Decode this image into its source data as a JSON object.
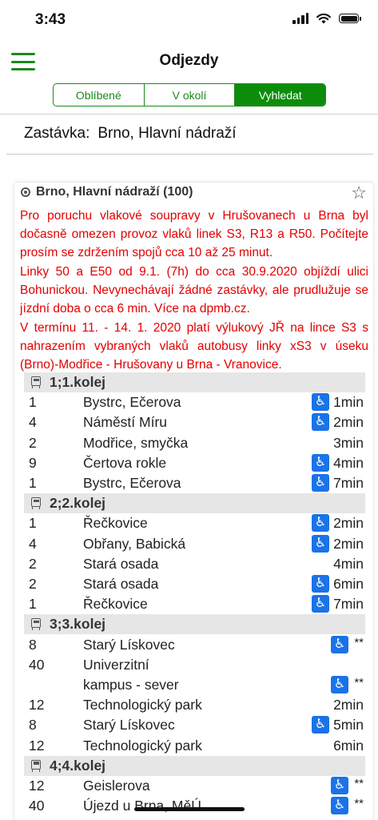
{
  "status_bar": {
    "time": "3:43"
  },
  "nav": {
    "title": "Odjezdy",
    "tabs": [
      {
        "label": "Oblíbené",
        "active": false
      },
      {
        "label": "V okolí",
        "active": false
      },
      {
        "label": "Vyhledat",
        "active": true
      }
    ]
  },
  "stop": {
    "label": "Zastávka:",
    "value": "Brno, Hlavní nádraží"
  },
  "card": {
    "title": "Brno, Hlavní nádraží (100)",
    "notices": [
      "Pro poruchu vlakové soupravy v Hrušovanech u Brna byl dočasně omezen provoz vlaků linek S3, R13 a R50. Počítejte prosím se zdržením spojů cca 10 až 25 minut.",
      "Linky 50 a E50 od 9.1. (7h) do cca 30.9.2020 objíždí ulici Bohunickou. Nevynechávají žádné zastávky, ale prudlužuje se jízdní doba o cca 6 min. Více na dpmb.cz.",
      "V termínu 11. - 14. 1. 2020 platí výlukový JŘ na lince S3 s nahrazením vybraných vlaků autobusy linky xS3 v úseku (Brno)-Modřice - Hrušovany u Brna - Vranovice."
    ],
    "platforms": [
      {
        "name": "1;1.kolej",
        "departures": [
          {
            "line": "1",
            "destination": "Bystrc, Ečerova",
            "accessible": true,
            "time": "1min"
          },
          {
            "line": "4",
            "destination": "Náměstí Míru",
            "accessible": true,
            "time": "2min"
          },
          {
            "line": "2",
            "destination": "Modřice, smyčka",
            "accessible": false,
            "time": "3min"
          },
          {
            "line": "9",
            "destination": "Čertova rokle",
            "accessible": true,
            "time": "4min"
          },
          {
            "line": "1",
            "destination": "Bystrc, Ečerova",
            "accessible": true,
            "time": "7min"
          }
        ]
      },
      {
        "name": "2;2.kolej",
        "departures": [
          {
            "line": "1",
            "destination": "Řečkovice",
            "accessible": true,
            "time": "2min"
          },
          {
            "line": "4",
            "destination": "Obřany, Babická",
            "accessible": true,
            "time": "2min"
          },
          {
            "line": "2",
            "destination": "Stará osada",
            "accessible": false,
            "time": "4min"
          },
          {
            "line": "2",
            "destination": "Stará osada",
            "accessible": true,
            "time": "6min"
          },
          {
            "line": "1",
            "destination": "Řečkovice",
            "accessible": true,
            "time": "7min"
          }
        ]
      },
      {
        "name": "3;3.kolej",
        "departures": [
          {
            "line": "8",
            "destination": "Starý Lískovec",
            "accessible": true,
            "time": "**"
          },
          {
            "line": "40",
            "destination": "Univerzitní",
            "accessible": false,
            "time": ""
          },
          {
            "line": "",
            "destination": "kampus - sever",
            "accessible": true,
            "time": "**"
          },
          {
            "line": "12",
            "destination": "Technologický park",
            "accessible": false,
            "time": "2min"
          },
          {
            "line": "8",
            "destination": "Starý Lískovec",
            "accessible": true,
            "time": "5min"
          },
          {
            "line": "12",
            "destination": "Technologický park",
            "accessible": false,
            "time": "6min"
          }
        ]
      },
      {
        "name": "4;4.kolej",
        "departures": [
          {
            "line": "12",
            "destination": "Geislerova",
            "accessible": true,
            "time": "**"
          },
          {
            "line": "40",
            "destination": "Újezd u Brna, MěÚ",
            "accessible": true,
            "time": "**"
          }
        ]
      }
    ]
  }
}
